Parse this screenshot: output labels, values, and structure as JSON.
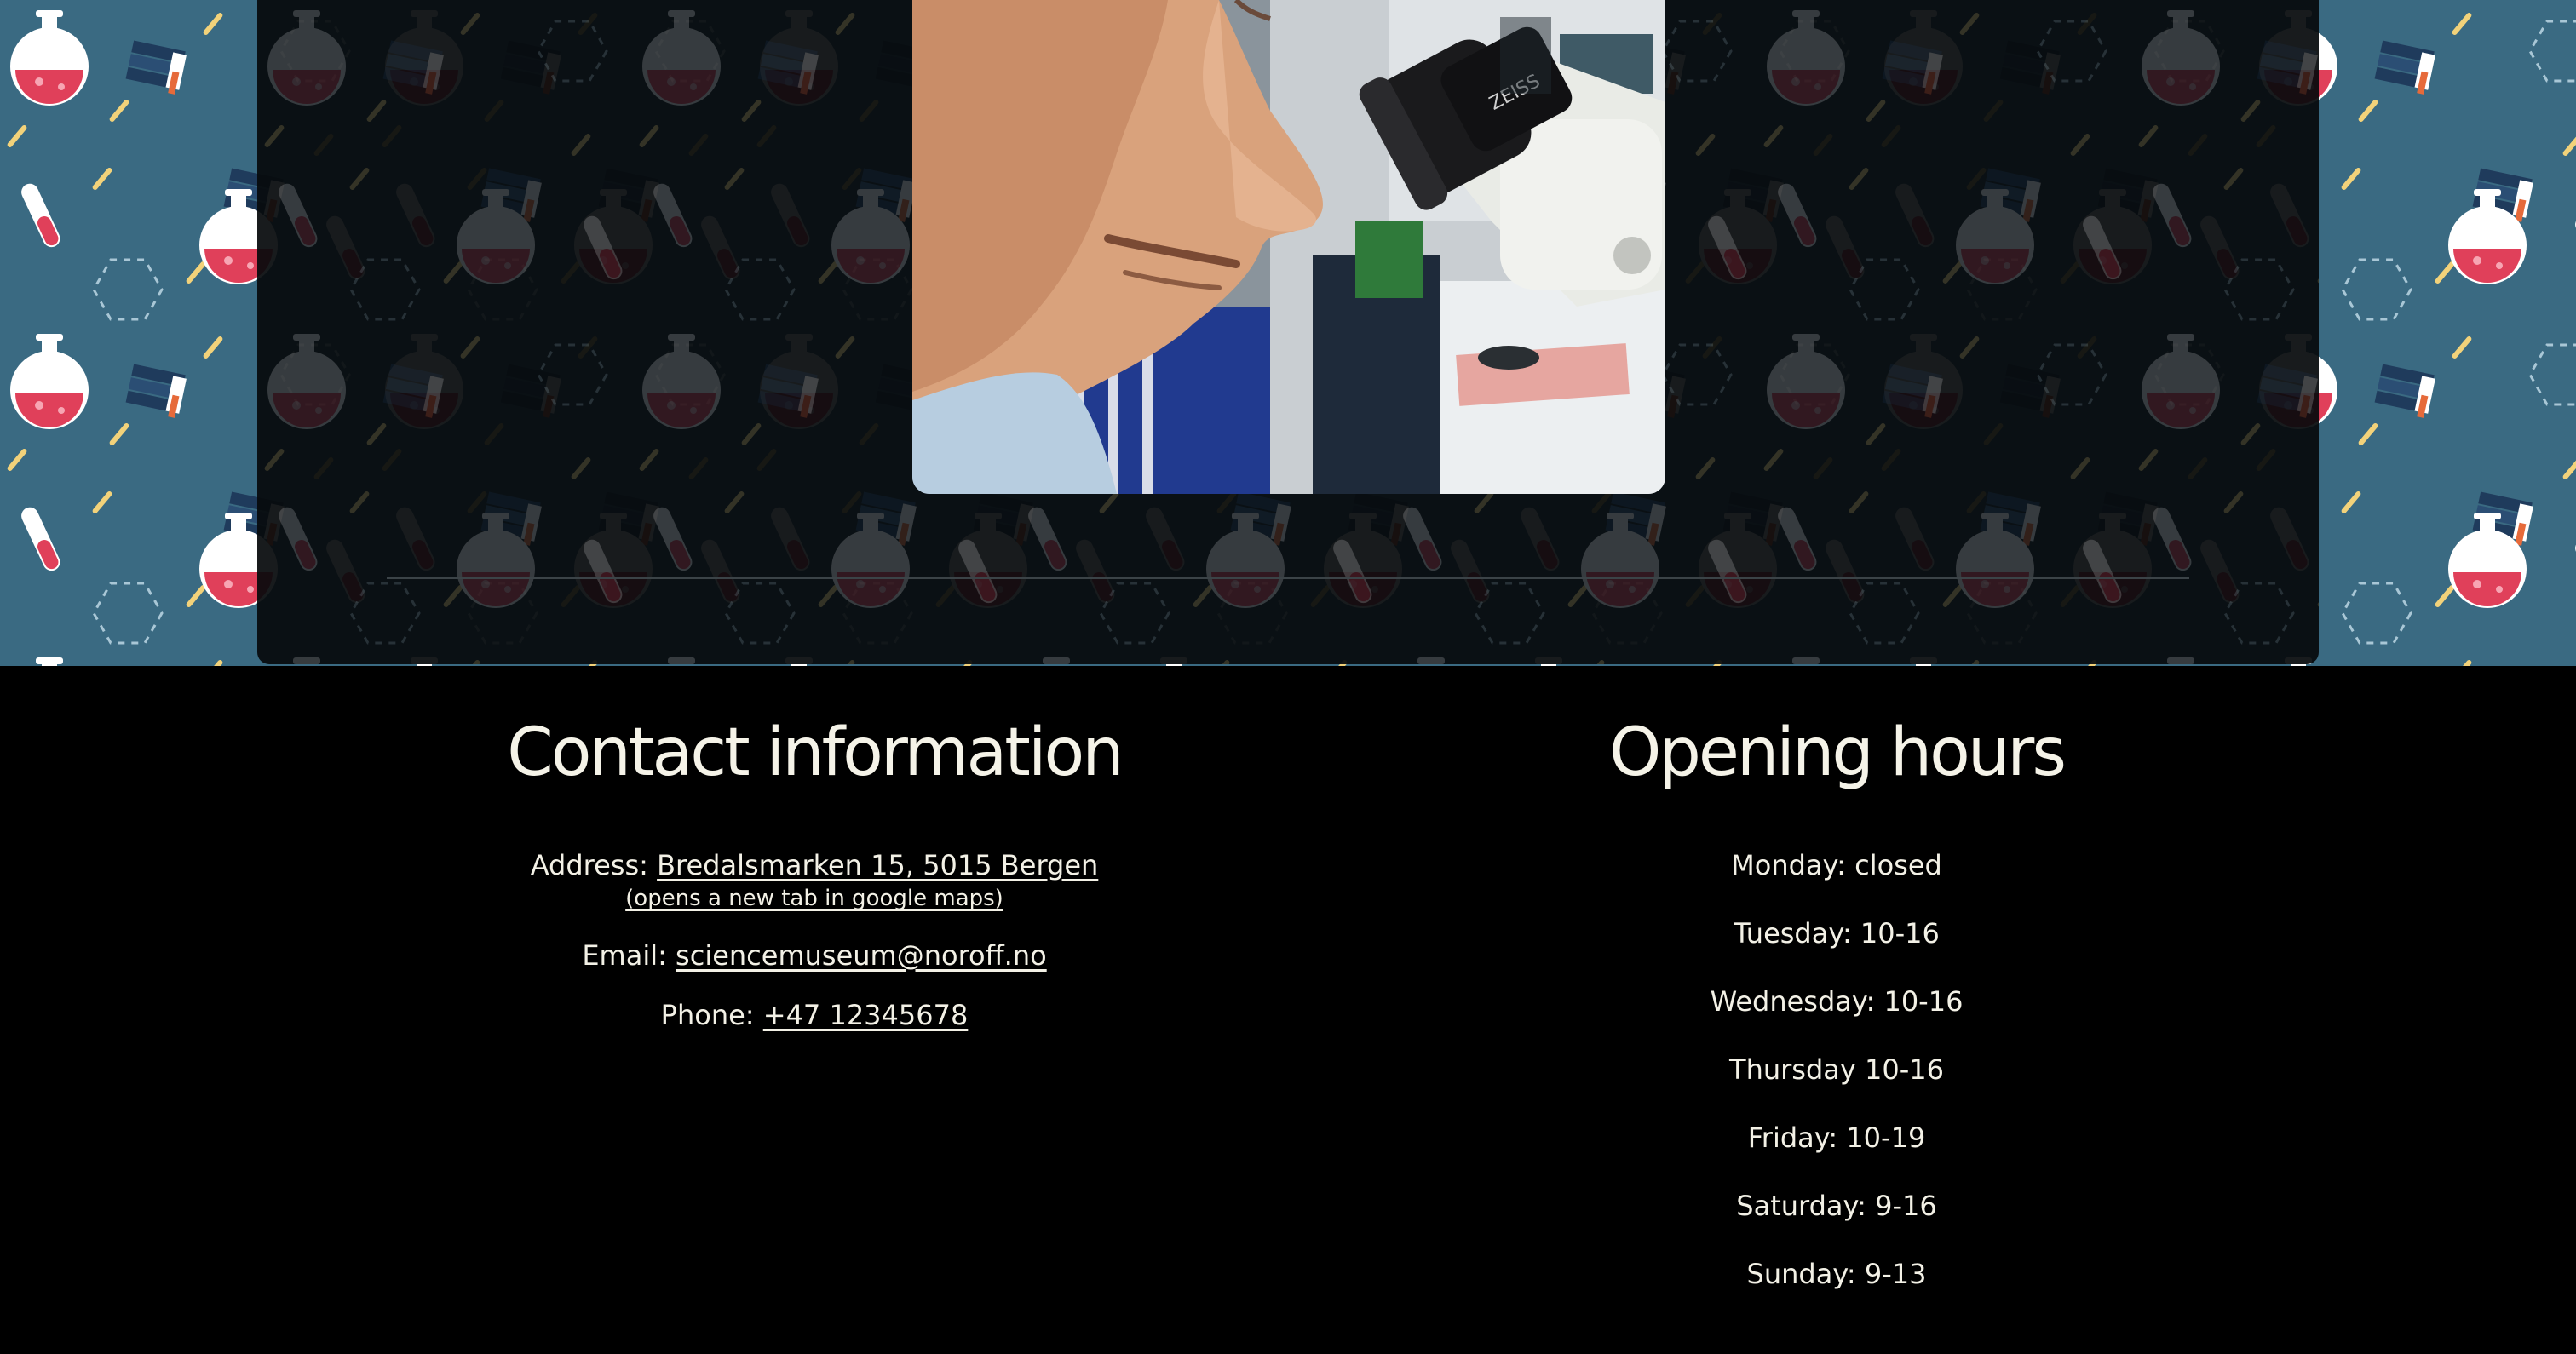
{
  "hero": {
    "image_alt": "Scientist looking into a microscope"
  },
  "contact": {
    "title": "Contact information",
    "address_label": "Address:",
    "address_value": "Bredalsmarken 15, 5015 Bergen",
    "address_note": "(opens a new tab in google maps)",
    "email_label": "Email:",
    "email_value": "sciencemuseum@noroff.no",
    "phone_label": "Phone:",
    "phone_value": "+47 12345678"
  },
  "hours": {
    "title": "Opening hours",
    "days": [
      "Monday: closed",
      "Tuesday: 10-16",
      "Wednesday: 10-16",
      "Thursday 10-16",
      "Friday: 10-19",
      "Saturday: 9-16",
      "Sunday: 9-13"
    ]
  },
  "colors": {
    "pattern_bg": "#3a6a82",
    "panel_bg": "#060a0c",
    "footer_bg": "#000000",
    "text": "#f3f1e6",
    "flask_red": "#e0405a",
    "accent_yellow": "#f2d27a"
  }
}
